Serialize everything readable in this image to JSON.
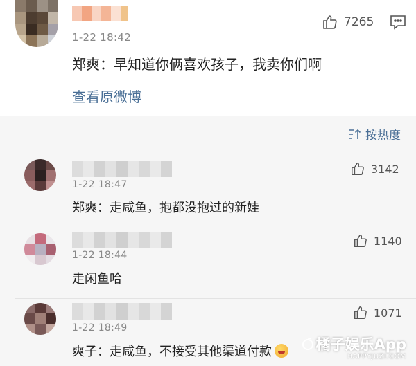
{
  "main_post": {
    "time": "1-22 18:42",
    "like_count": "7265",
    "text": "郑爽：早知道你俩喜欢孩子，我卖你们啊",
    "view_original": "查看原微博"
  },
  "sort": {
    "label": "按热度"
  },
  "comments": [
    {
      "time": "1-22 18:47",
      "likes": "3142",
      "text": "郑爽：走咸鱼，抱都没抱过的新娃"
    },
    {
      "time": "1-22 18:44",
      "likes": "1140",
      "text": "走闲鱼哈"
    },
    {
      "time": "1-22 18:49",
      "likes": "1071",
      "text": "爽子：走咸鱼，不接受其他渠道付款"
    }
  ],
  "watermark": {
    "brand": "橘子娱乐App",
    "url": "HAPPYJUZI.COM"
  },
  "colors": {
    "link": "#4a6f96",
    "page_bg": "#f2f2f2"
  }
}
